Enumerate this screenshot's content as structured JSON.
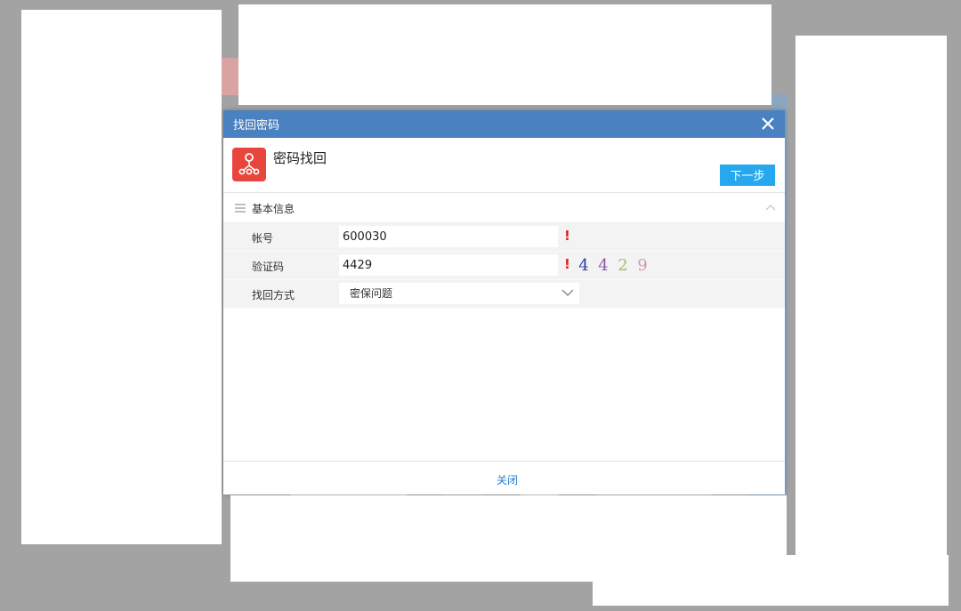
{
  "dialog": {
    "title": "找回密码",
    "header_title": "密码找回",
    "next_label": "下一步",
    "close_label": "关闭"
  },
  "section": {
    "title": "基本信息"
  },
  "form": {
    "account": {
      "label": "帐号",
      "value": "600030",
      "required_mark": "!"
    },
    "captcha": {
      "label": "验证码",
      "value": "4429",
      "required_mark": "!"
    },
    "method": {
      "label": "找回方式",
      "selected": "密保问题"
    }
  },
  "captcha_image": {
    "digits": [
      "4",
      "4",
      "2",
      "9"
    ],
    "colors": [
      "#2b3f9e",
      "#8a5aa8",
      "#9cc06a",
      "#d59aa6"
    ]
  },
  "icons": {
    "close": "close-icon",
    "app": "org-tree-icon",
    "menu": "menu-lines-icon",
    "collapse": "chevron-up-icon",
    "dropdown": "chevron-down-icon"
  },
  "colors": {
    "titlebar": "#4a81c0",
    "primary_button": "#27a8ee",
    "app_icon": "#e8453c",
    "required": "#e02020",
    "link": "#2a7fd6"
  }
}
